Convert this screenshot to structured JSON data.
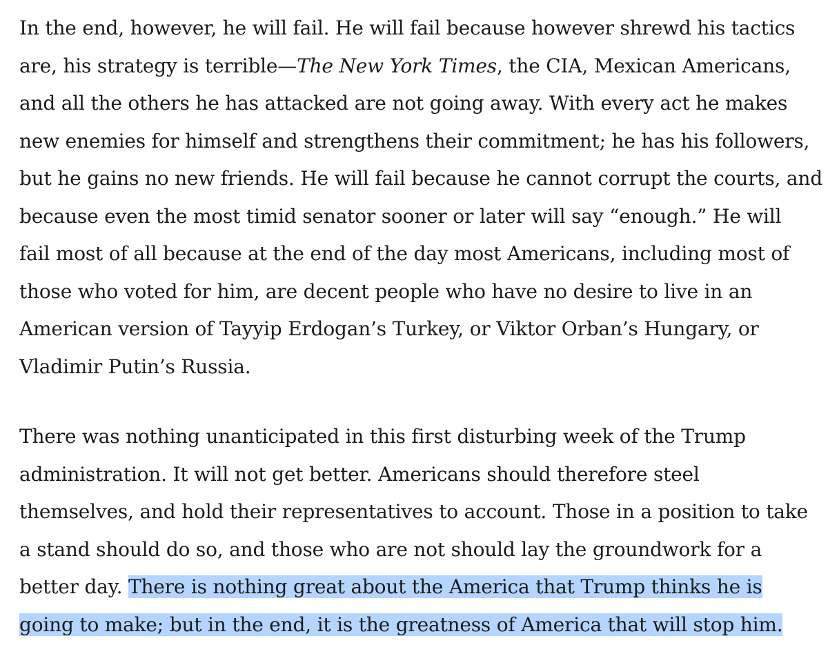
{
  "article": {
    "paragraph_1": {
      "line_1": "In the end, however, he will fail. He will fail because however shrewd his tactics",
      "line_2_before": "are, his strategy is terrible—",
      "line_2_title": "The New York Times",
      "line_2_after": ", the CIA, Mexican Americans,",
      "line_3": "and all the others he has attacked are not going away. With every act he makes",
      "line_4": "new enemies for himself and strengthens their commitment; he has his followers,",
      "line_5": "but he gains no new friends. He will fail because he cannot corrupt the courts, and",
      "line_6": "because even the most timid senator sooner or later will say “enough.” He will",
      "line_7": "fail most of all because at the end of the day most Americans, including most of",
      "line_8": "those who voted for him, are decent people who have no desire to live in an",
      "line_9": "American version of Tayyip Erdogan’s Turkey, or Viktor Orban’s Hungary, or",
      "line_10": "Vladimir Putin’s Russia."
    },
    "paragraph_2": {
      "line_1": "There was nothing unanticipated in this first disturbing week of the Trump",
      "line_2": "administration. It will not get better. Americans should therefore steel",
      "line_3": "themselves, and hold their representatives to account. Those in a position to take",
      "line_4": "a stand should do so, and those who are not should lay the groundwork for a",
      "line_5_before": "better day. ",
      "line_5_highlight": "There is nothing great about the America that Trump thinks he is",
      "line_6_highlight": "going to make; but in the end, it is the greatness of America that will stop him."
    },
    "highlight_color": "#b4d5fe",
    "text_color": "#1b1b1b"
  }
}
